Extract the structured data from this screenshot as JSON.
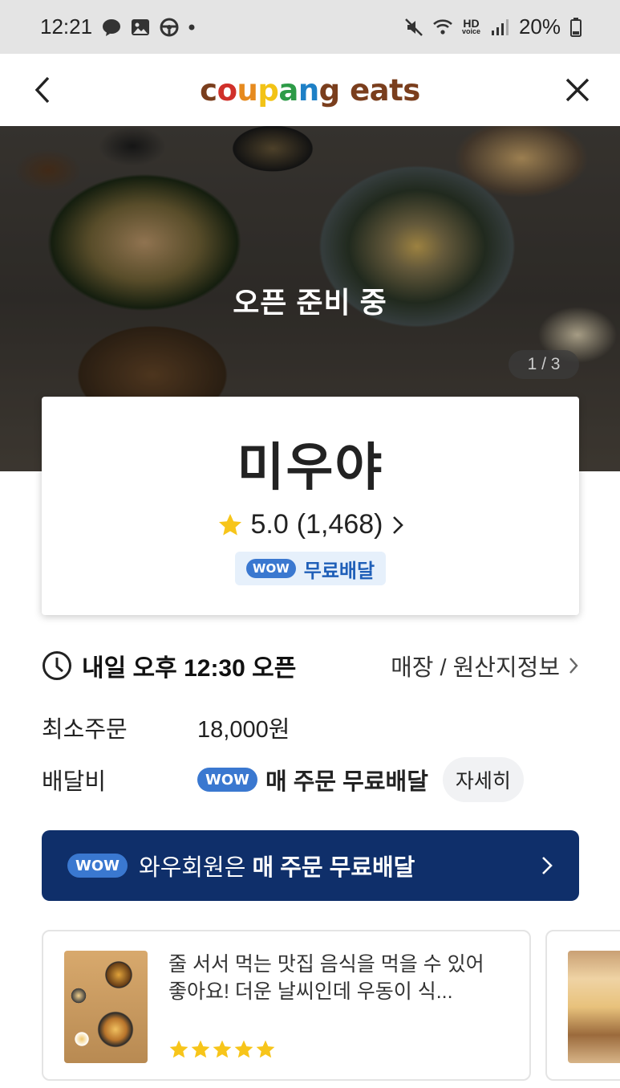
{
  "status_bar": {
    "time": "12:21",
    "left_icons": [
      "kakaotalk-icon",
      "gallery-icon",
      "steering-wheel-icon",
      "dot-icon"
    ],
    "right_icons": [
      "mute-icon",
      "wifi-icon",
      "hd-voice-icon",
      "signal-icon",
      "battery-icon"
    ],
    "hd_label": "HD",
    "hd_sub": "voice",
    "battery": "20%"
  },
  "header": {
    "logo_word1": "coupang",
    "logo_word2": "eats",
    "logo_colors": [
      "#7a3e1d",
      "#d0302a",
      "#e68a1e",
      "#f2c316",
      "#2d9b47",
      "#1e80c6",
      "#7a3e1d"
    ]
  },
  "hero": {
    "overlay_text": "오픈 준비 중",
    "counter": "1 / 3"
  },
  "store": {
    "name": "미우야",
    "rating": "5.0",
    "review_count": "(1,468)",
    "badge_wow": "WOW",
    "badge_label": "무료배달"
  },
  "info": {
    "open_time": "내일 오후 12:30 오픈",
    "store_info_link": "매장 / 원산지정보",
    "min_order_label": "최소주문",
    "min_order_value": "18,000원",
    "delivery_fee_label": "배달비",
    "delivery_wow": "WOW",
    "delivery_value": "매 주문 무료배달",
    "detail_button": "자세히"
  },
  "banner": {
    "wow": "WOW",
    "text_plain": "와우회원은 ",
    "text_bold": "매 주문 무료배달"
  },
  "reviews": [
    {
      "text": "줄 서서 먹는 맛집 음식을 먹을 수 있어 좋아요! 더운 날씨인데 우동이 식...",
      "stars": 5
    }
  ],
  "colors": {
    "star": "#f7c51a",
    "wow_blue": "#3a78d0",
    "banner_navy": "#0f2f6a"
  }
}
